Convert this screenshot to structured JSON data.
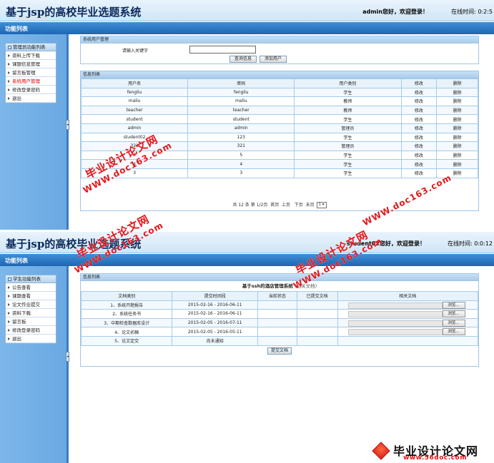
{
  "admin_view": {
    "app_title": "基于jsp的高校毕业选题系统",
    "welcome_text": "admin您好，欢迎登录！",
    "online_text": "在线时间: 0:2:5",
    "nav_title": "功能列表",
    "menu_header": "管理员功能列表",
    "menu_items": [
      "资料上传下载",
      "课题信息管理",
      "留言板管理",
      "系统用户管理",
      "修改登录密码",
      "退出"
    ],
    "active_menu": "系统用户管理",
    "search_panel": {
      "title": "系统用户管理",
      "label": "请输入关键字",
      "value": "",
      "placeholder": "",
      "query_button": "查询信息",
      "add_button": "添加用户"
    },
    "list_panel": {
      "title": "信息列表",
      "columns": [
        "用户名",
        "密码",
        "用户类别",
        "修改",
        "删除"
      ],
      "rows": [
        [
          "fengliu",
          "fengliu",
          "学生",
          "修改",
          "删除"
        ],
        [
          "maliu",
          "maliu",
          "教师",
          "修改",
          "删除"
        ],
        [
          "teacher",
          "teacher",
          "教师",
          "修改",
          "删除"
        ],
        [
          "student",
          "student",
          "学生",
          "修改",
          "删除"
        ],
        [
          "admin",
          "admin",
          "管理员",
          "修改",
          "删除"
        ],
        [
          "student02",
          "123",
          "学生",
          "修改",
          "删除"
        ],
        [
          "321",
          "321",
          "管理员",
          "修改",
          "删除"
        ],
        [
          "5",
          "5",
          "学生",
          "修改",
          "删除"
        ],
        [
          "4",
          "4",
          "学生",
          "修改",
          "删除"
        ],
        [
          "3",
          "3",
          "学生",
          "修改",
          "删除"
        ]
      ]
    },
    "pager": {
      "summary": "共 12 条 第 1/2页",
      "first": "首页",
      "prev": "上页",
      "next": "下页",
      "last": "末页",
      "page_select": "1"
    }
  },
  "student_view": {
    "app_title": "基于jsp的高校毕业选题系统",
    "welcome_text": "student02您好，欢迎登录！",
    "online_text": "在线时间: 0:0:12",
    "nav_title": "功能列表",
    "menu_header": "学生功能列表",
    "menu_items": [
      "公告查看",
      "课题查看",
      "论文作业提交",
      "资料下载",
      "留言板",
      "修改登录密码",
      "退出"
    ],
    "panel_title": "信息列表",
    "doc_title": "基于ssh的酒店管理系统",
    "doc_note": "(相关文档)",
    "columns": [
      "文档类别",
      "提交时间段",
      "当前状态",
      "已提交文档",
      "相关文档"
    ],
    "rows": [
      [
        "1、系统开题报告",
        "2015-02-16 - 2016-06-11"
      ],
      [
        "2、系统任务书",
        "2015-02-16 - 2016-06-11"
      ],
      [
        "3、中期检查数据库设计",
        "2015-02-05 - 2016-07-11"
      ],
      [
        "4、论文初稿",
        "2015-02-05 - 2016-05-11"
      ],
      [
        "5、论文定交",
        "尚未通知"
      ]
    ],
    "browse_label": "浏览...",
    "submit_button": "提交文档"
  },
  "watermarks": {
    "cn": "毕业设计论文网",
    "url": "WWW.doc163.com",
    "logo_cn": "毕业设计论文网",
    "logo_url": "www.56doc.com"
  }
}
